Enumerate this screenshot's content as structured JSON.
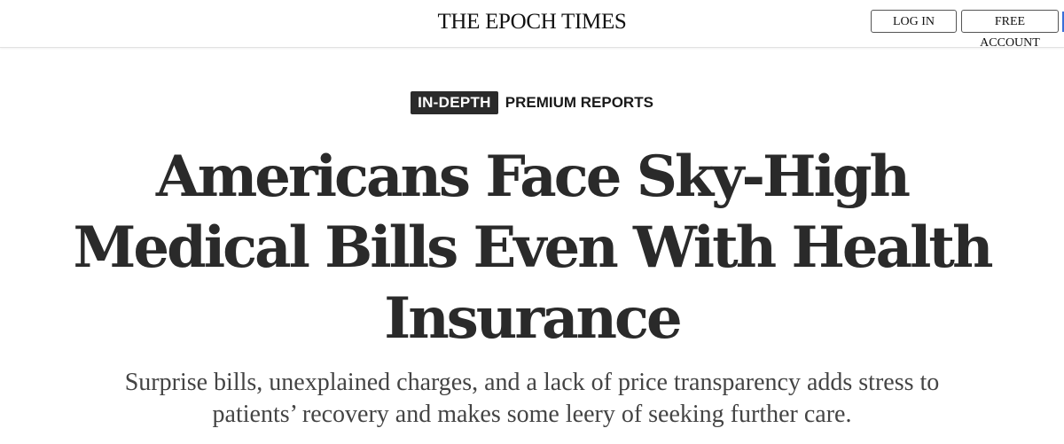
{
  "header": {
    "logo": "THE EPOCH TIMES",
    "login_label": "LOG IN",
    "free_account_label": "FREE ACCOUNT"
  },
  "article": {
    "badge": "IN-DEPTH",
    "section": "PREMIUM REPORTS",
    "headline": "Americans Face Sky-High Medical Bills Even With Health Insurance",
    "dek": "Surprise bills, unexplained charges, and a lack of price transparency adds stress to patients’ recovery and makes some leery of seeking further care."
  },
  "colors": {
    "badge_bg": "#2b2b2b",
    "headline": "#2a2a2a",
    "dek": "#444444"
  }
}
